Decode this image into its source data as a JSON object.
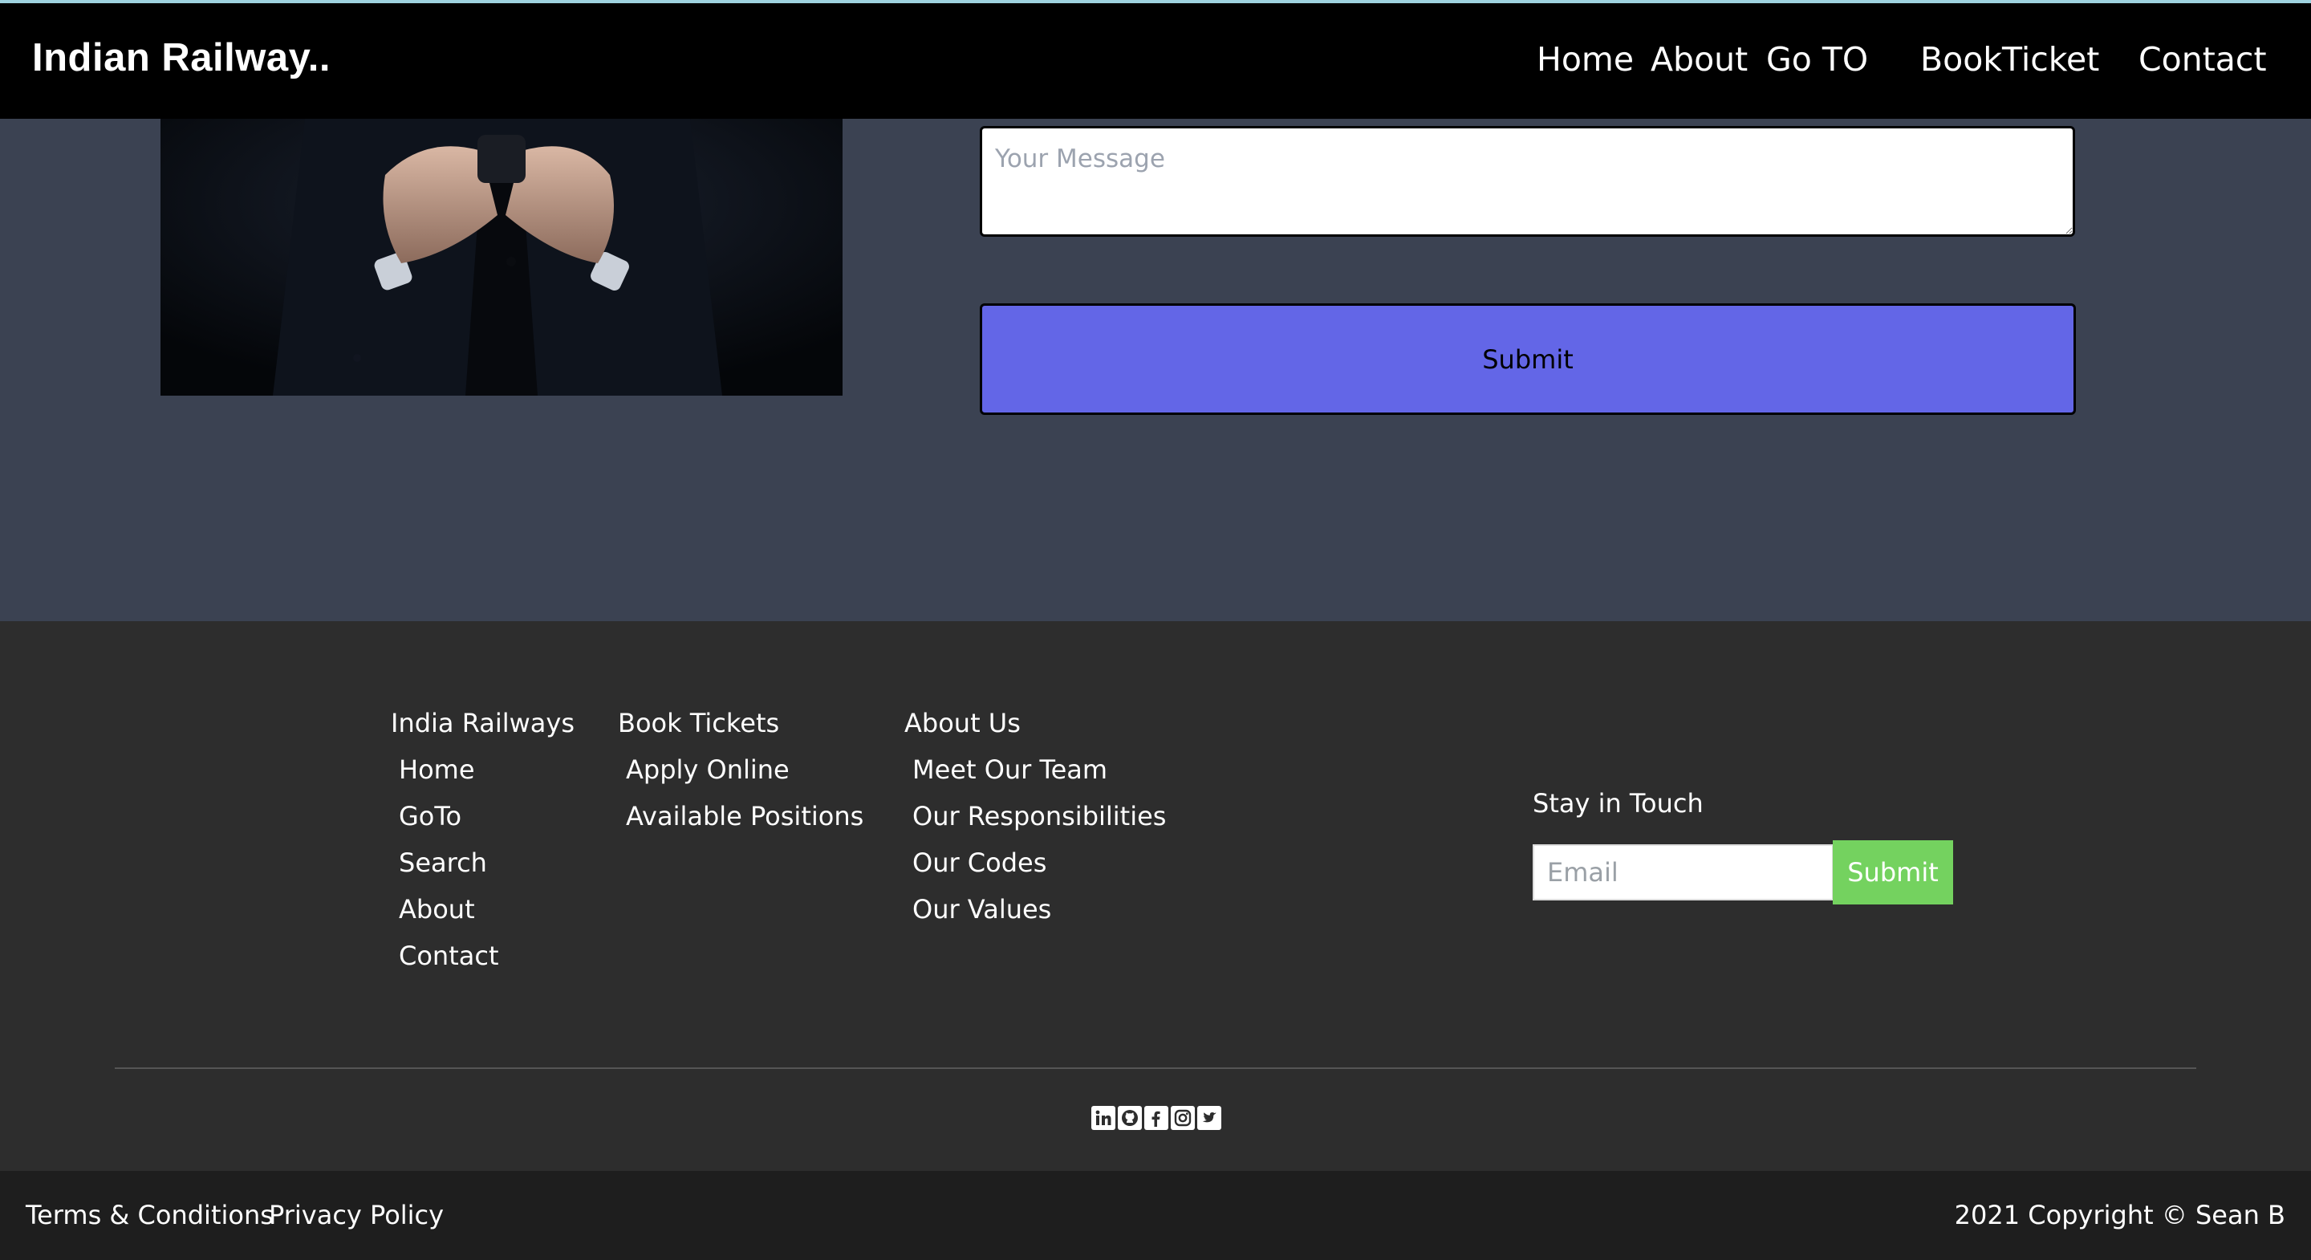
{
  "header": {
    "brand": "Indian Railway..",
    "nav": [
      "Home",
      "About",
      "Go TO",
      "BookTicket",
      "Contact"
    ]
  },
  "contact_form": {
    "message_placeholder": "Your Message",
    "message_value": "",
    "submit_label": "Submit"
  },
  "footer": {
    "columns": [
      {
        "title": "India Railways",
        "links": [
          "Home",
          "GoTo",
          "Search",
          "About",
          "Contact"
        ]
      },
      {
        "title": "Book Tickets",
        "links": [
          "Apply Online",
          "Available Positions"
        ]
      },
      {
        "title": "About Us",
        "links": [
          "Meet Our Team",
          "Our Responsibilities",
          "Our Codes",
          "Our Values"
        ]
      }
    ],
    "newsletter": {
      "title": "Stay in Touch",
      "email_placeholder": "Email",
      "email_value": "",
      "submit_label": "Submit"
    },
    "social_icons": [
      "linkedin-icon",
      "github-icon",
      "facebook-icon",
      "instagram-icon",
      "twitter-icon"
    ]
  },
  "bottom_bar": {
    "links": [
      "Terms & Conditions",
      "Privacy Policy"
    ],
    "copyright": "2021 Copyright © Sean B"
  },
  "colors": {
    "navbar": "#000000",
    "section_bg": "#3b4252",
    "footer_bg": "#2d2d2d",
    "bottom_bar_bg": "#1e1e1e",
    "submit_accent": "#6366e7",
    "newsletter_accent": "#74d25f"
  }
}
